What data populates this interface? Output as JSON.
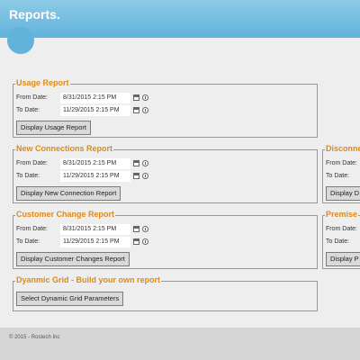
{
  "header": {
    "title": "Reports."
  },
  "usage": {
    "legend": "Usage Report",
    "from_label": "From Date:",
    "from_value": "8/31/2015 2:15 PM",
    "to_label": "To Date:",
    "to_value": "11/29/2015 2:15 PM",
    "button": "Display Usage Report"
  },
  "new_connections": {
    "legend": "New Connections Report",
    "from_label": "From Date:",
    "from_value": "8/31/2015 2:15 PM",
    "to_label": "To Date:",
    "to_value": "11/29/2015 2:15 PM",
    "button": "Display New Connection Report"
  },
  "customer_change": {
    "legend": "Customer Change Report",
    "from_label": "From Date:",
    "from_value": "8/31/2015 2:15 PM",
    "to_label": "To Date:",
    "to_value": "11/29/2015 2:15 PM",
    "button": "Display Customer Changes Report"
  },
  "disconnect": {
    "legend": "Disconne",
    "from_label": "From Date:",
    "to_label": "To Date:",
    "button": "Display D"
  },
  "premise": {
    "legend": "Premise",
    "from_label": "From Date:",
    "to_label": "To Date:",
    "button": "Display P"
  },
  "dynamic_grid": {
    "legend": "Dyanmic Grid - Build your own report",
    "button": "Select Dynamic Grid Parameters"
  },
  "footer": {
    "copyright": "© 2015 - Rostech Inc"
  },
  "icons": {
    "calendar": "calendar-icon",
    "clock": "clock-icon"
  }
}
